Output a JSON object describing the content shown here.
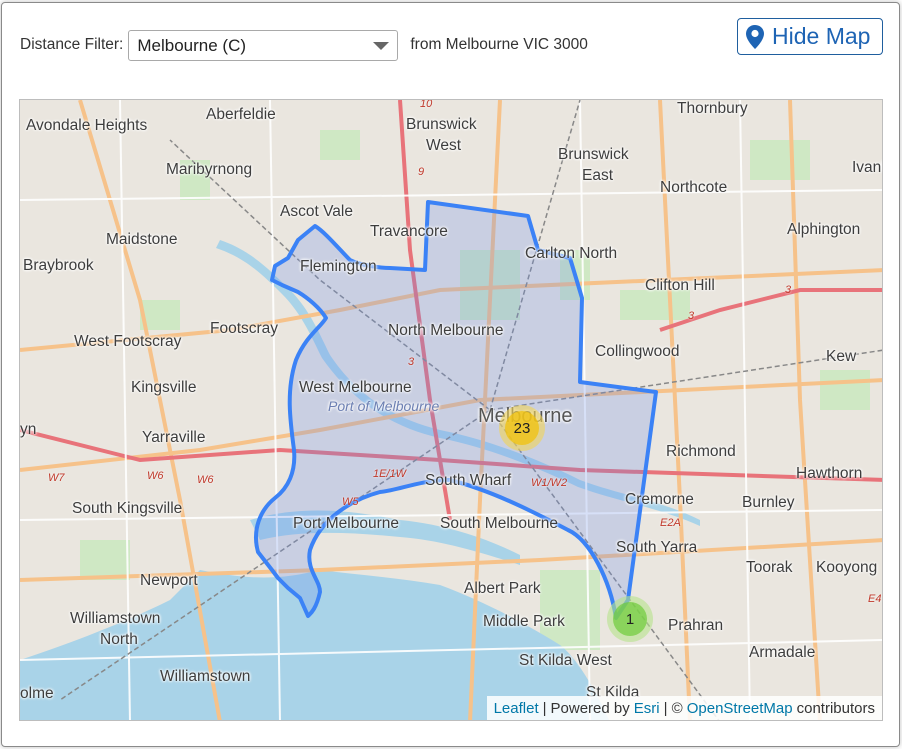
{
  "filter": {
    "label": "Distance Filter:",
    "selected": "Melbourne (C)",
    "from_text": "from Melbourne VIC 3000"
  },
  "hide_map_button": {
    "label": "Hide Map",
    "icon": "map-marker-icon",
    "color": "#1e64b4"
  },
  "map": {
    "boundary_color": "#3b82f6",
    "places": [
      "Avondale Heights",
      "Aberfeldie",
      "Maribyrnong",
      "Ascot Vale",
      "Maidstone",
      "Braybrook",
      "Flemington",
      "Travancore",
      "Brunswick",
      "West",
      "Brunswick",
      "East",
      "Thornbury",
      "Northcote",
      "Alphington",
      "Ivanho",
      "Carlton North",
      "Clifton Hill",
      "Footscray",
      "North Melbourne",
      "Collingwood",
      "Kew",
      "West Footscray",
      "Kingsville",
      "West Melbourne",
      "Melbourne",
      "Yarraville",
      "Richmond",
      "Hawthorn",
      "South Kingsville",
      "South Wharf",
      "Cremorne",
      "Burnley",
      "Port Melbourne",
      "South Melbourne",
      "South Yarra",
      "Toorak",
      "Kooyong",
      "Newport",
      "Albert Park",
      "Williamstown",
      "North",
      "Middle Park",
      "Prahran",
      "Armadale",
      "St Kilda West",
      "Williamstown",
      "St Kilda",
      "olme",
      "yn"
    ],
    "water_label": "Port of Melbourne",
    "road_numbers": [
      "10",
      "9",
      "3",
      "3",
      "3",
      "W7",
      "W6",
      "W6",
      "1E/1W",
      "W5",
      "W1/W2",
      "E2A",
      "E4"
    ],
    "clusters": [
      {
        "count": "23",
        "color": "#f0c20c"
      },
      {
        "count": "1",
        "color": "#6ecc39"
      }
    ]
  },
  "attribution": {
    "leaflet": "Leaflet",
    "sep1": "|",
    "powered": "Powered by",
    "esri": "Esri",
    "sep2": "| ©",
    "osm": "OpenStreetMap",
    "contributors": "contributors"
  }
}
